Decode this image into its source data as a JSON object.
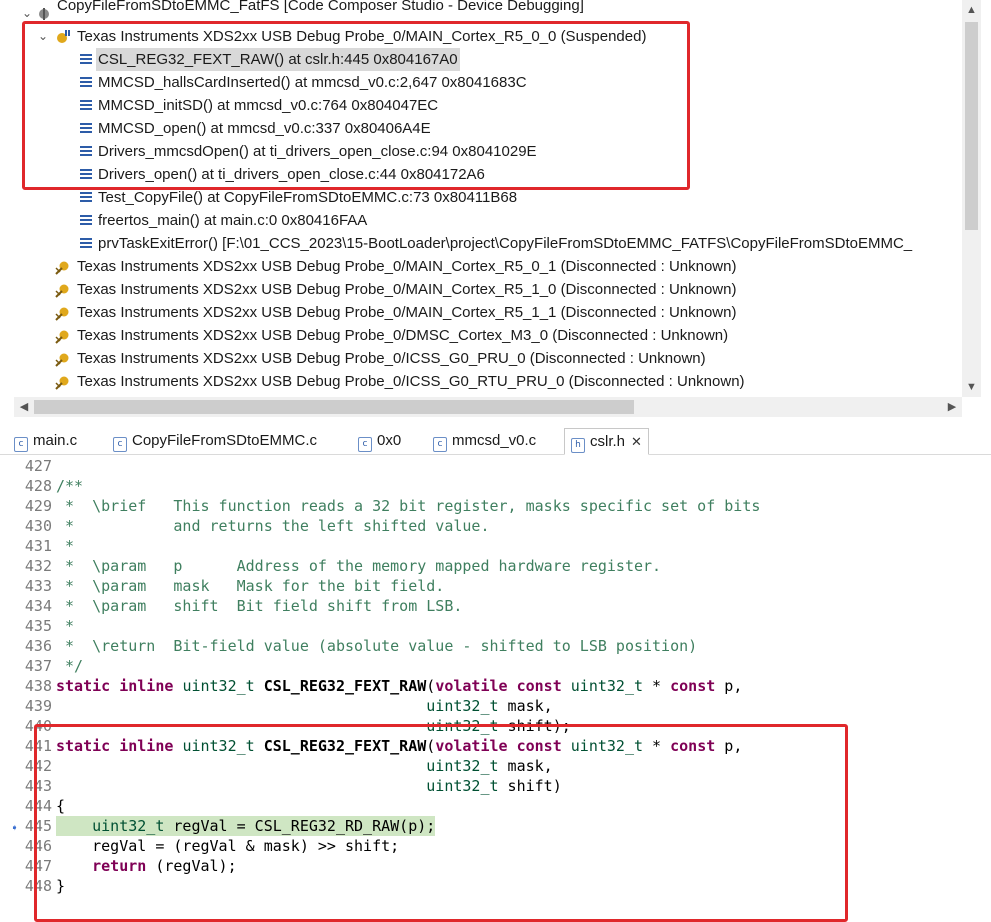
{
  "debug": {
    "title": "CopyFileFromSDtoEMMC_FatFS [Code Composer Studio - Device Debugging]",
    "threads": [
      {
        "label": "Texas Instruments XDS2xx USB Debug Probe_0/MAIN_Cortex_R5_0_0 (Suspended)",
        "icon": "suspended-target-icon"
      },
      {
        "label": "Texas Instruments XDS2xx USB Debug Probe_0/MAIN_Cortex_R5_0_1 (Disconnected : Unknown)",
        "icon": "disconnected-target-icon"
      },
      {
        "label": "Texas Instruments XDS2xx USB Debug Probe_0/MAIN_Cortex_R5_1_0 (Disconnected : Unknown)",
        "icon": "disconnected-target-icon"
      },
      {
        "label": "Texas Instruments XDS2xx USB Debug Probe_0/MAIN_Cortex_R5_1_1 (Disconnected : Unknown)",
        "icon": "disconnected-target-icon"
      },
      {
        "label": "Texas Instruments XDS2xx USB Debug Probe_0/DMSC_Cortex_M3_0 (Disconnected : Unknown)",
        "icon": "disconnected-target-icon"
      },
      {
        "label": "Texas Instruments XDS2xx USB Debug Probe_0/ICSS_G0_PRU_0 (Disconnected : Unknown)",
        "icon": "disconnected-target-icon"
      },
      {
        "label": "Texas Instruments XDS2xx USB Debug Probe_0/ICSS_G0_RTU_PRU_0 (Disconnected : Unknown)",
        "icon": "disconnected-target-icon"
      }
    ],
    "frames": [
      "CSL_REG32_FEXT_RAW() at cslr.h:445 0x804167A0",
      "MMCSD_hallsCardInserted() at mmcsd_v0.c:2,647 0x8041683C",
      "MMCSD_initSD() at mmcsd_v0.c:764 0x804047EC",
      "MMCSD_open() at mmcsd_v0.c:337 0x80406A4E",
      "Drivers_mmcsdOpen() at ti_drivers_open_close.c:94 0x8041029E",
      "Drivers_open() at ti_drivers_open_close.c:44 0x804172A6",
      "Test_CopyFile() at CopyFileFromSDtoEMMC.c:73 0x80411B68",
      "freertos_main() at main.c:0 0x80416FAA",
      "prvTaskExitError() [F:\\01_CCS_2023\\15-BootLoader\\project\\CopyFileFromSDtoEMMC_FATFS\\CopyFileFromSDtoEMMC_"
    ]
  },
  "editor": {
    "tabs": [
      {
        "label": "main.c",
        "active": false
      },
      {
        "label": "CopyFileFromSDtoEMMC.c",
        "active": false
      },
      {
        "label": "0x0",
        "active": false
      },
      {
        "label": "mmcsd_v0.c",
        "active": false
      },
      {
        "label": "cslr.h",
        "active": true
      }
    ],
    "lines": [
      {
        "n": "427",
        "text": ""
      },
      {
        "n": "428",
        "text": "/**"
      },
      {
        "n": "429",
        "text": " *  \\brief   This function reads a 32 bit register, masks specific set of bits"
      },
      {
        "n": "430",
        "text": " *           and returns the left shifted value."
      },
      {
        "n": "431",
        "text": " *"
      },
      {
        "n": "432",
        "text": " *  \\param   p      Address of the memory mapped hardware register."
      },
      {
        "n": "433",
        "text": " *  \\param   mask   Mask for the bit field."
      },
      {
        "n": "434",
        "text": " *  \\param   shift  Bit field shift from LSB."
      },
      {
        "n": "435",
        "text": " *"
      },
      {
        "n": "436",
        "text": " *  \\return  Bit-field value (absolute value - shifted to LSB position)"
      },
      {
        "n": "437",
        "text": " */"
      },
      {
        "n": "438",
        "text": "static inline uint32_t CSL_REG32_FEXT_RAW(volatile const uint32_t * const p,"
      },
      {
        "n": "439",
        "text": "                                         uint32_t mask,"
      },
      {
        "n": "440",
        "text": "                                         uint32_t shift);"
      },
      {
        "n": "441",
        "text": "static inline uint32_t CSL_REG32_FEXT_RAW(volatile const uint32_t * const p,"
      },
      {
        "n": "442",
        "text": "                                         uint32_t mask,"
      },
      {
        "n": "443",
        "text": "                                         uint32_t shift)"
      },
      {
        "n": "444",
        "text": "{"
      },
      {
        "n": "445",
        "text": "    uint32_t regVal = CSL_REG32_RD_RAW(p);"
      },
      {
        "n": "446",
        "text": "    regVal = (regVal & mask) >> shift;"
      },
      {
        "n": "447",
        "text": "    return (regVal);"
      },
      {
        "n": "448",
        "text": "}"
      }
    ],
    "current_line": "445"
  },
  "colors": {
    "annotation": "#e0282b",
    "comment": "#3f7f5f",
    "keyword": "#7f0055",
    "current_line": "#cfe6c3"
  }
}
